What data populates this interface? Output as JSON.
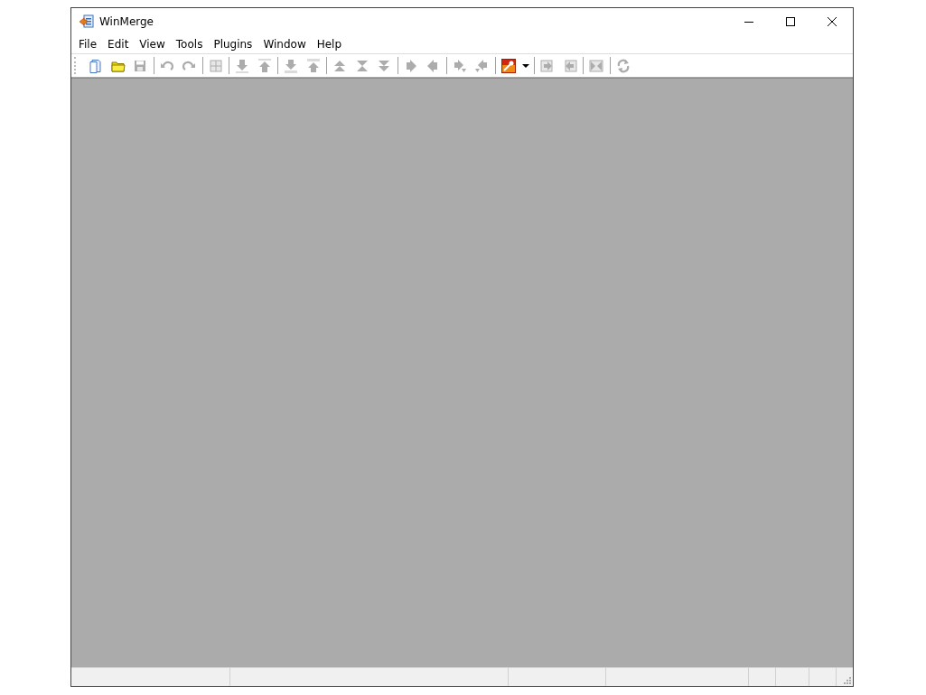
{
  "window": {
    "title": "WinMerge"
  },
  "menu": [
    {
      "label": "File"
    },
    {
      "label": "Edit"
    },
    {
      "label": "View"
    },
    {
      "label": "Tools"
    },
    {
      "label": "Plugins"
    },
    {
      "label": "Window"
    },
    {
      "label": "Help"
    }
  ],
  "toolbar": [
    [
      {
        "disabled": false
      },
      {
        "disabled": false
      },
      {
        "disabled": true
      }
    ],
    [
      {
        "disabled": true
      },
      {
        "disabled": true
      }
    ],
    [
      {
        "disabled": true
      }
    ],
    [
      {
        "disabled": true
      },
      {
        "disabled": true
      }
    ],
    [
      {
        "disabled": true
      },
      {
        "disabled": true
      }
    ],
    [
      {
        "disabled": true
      },
      {
        "disabled": true
      },
      {
        "disabled": true
      }
    ],
    [
      {
        "disabled": true
      },
      {
        "disabled": true
      }
    ],
    [
      {
        "disabled": true
      },
      {
        "disabled": true
      }
    ],
    [
      {
        "disabled": false
      },
      {
        "disabled": false
      }
    ],
    [
      {
        "disabled": true
      },
      {
        "disabled": true
      }
    ],
    [
      {
        "disabled": true
      }
    ],
    [
      {
        "disabled": true
      }
    ]
  ]
}
